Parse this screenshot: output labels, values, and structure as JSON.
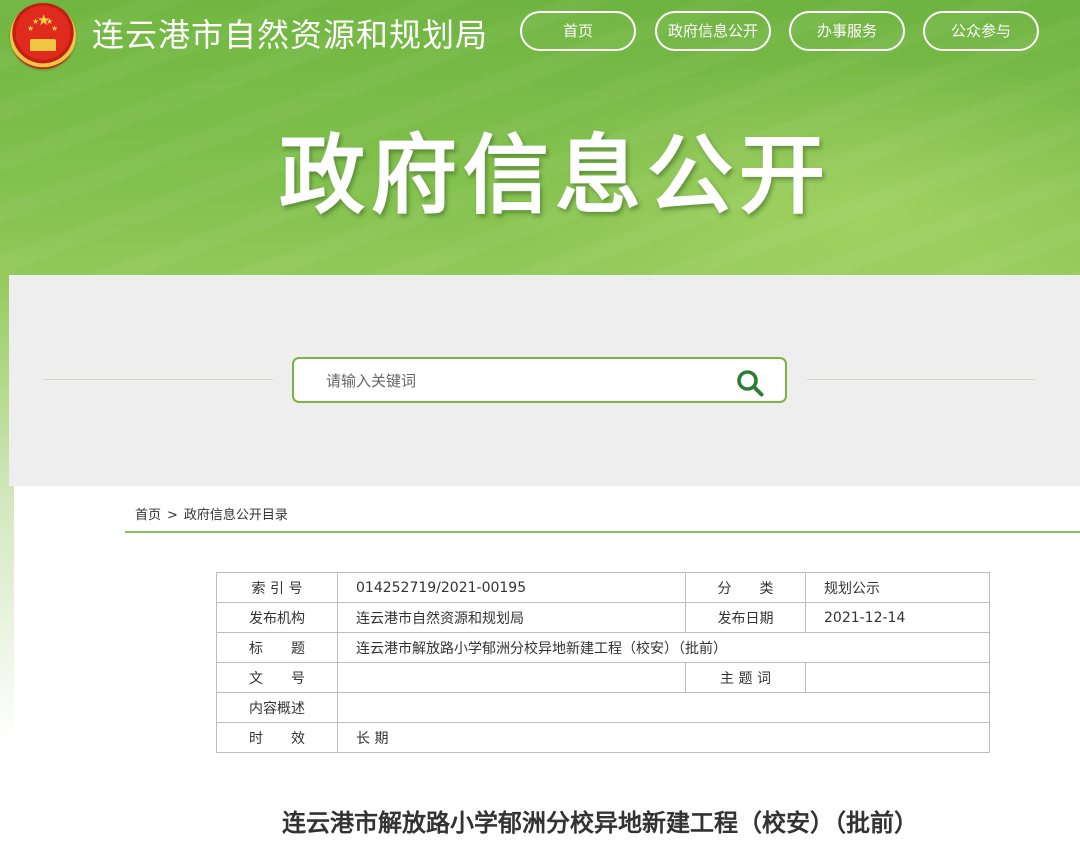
{
  "header": {
    "site_title": "连云港市自然资源和规划局",
    "nav": [
      {
        "label": "首页"
      },
      {
        "label": "政府信息公开"
      },
      {
        "label": "办事服务"
      },
      {
        "label": "公众参与"
      }
    ],
    "banner_title": "政府信息公开"
  },
  "search": {
    "placeholder": "请输入关键词",
    "accent_color": "#7cb342"
  },
  "breadcrumb": {
    "home": "首页",
    "separator": ">",
    "current": "政府信息公开目录"
  },
  "meta_table": {
    "index_label": "索 引 号",
    "index_value": "014252719/2021-00195",
    "category_label": "分　　类",
    "category_value": "规划公示",
    "publisher_label": "发布机构",
    "publisher_value": "连云港市自然资源和规划局",
    "date_label": "发布日期",
    "date_value": "2021-12-14",
    "title_label": "标　　题",
    "title_value": "连云港市解放路小学郁洲分校异地新建工程（校安）（批前）",
    "docno_label": "文　　号",
    "docno_value": "",
    "keywords_label": "主 题 词",
    "keywords_value": "",
    "summary_label": "内容概述",
    "summary_value": "",
    "validity_label": "时　　效",
    "validity_value": "长 期"
  },
  "document": {
    "title": "连云港市解放路小学郁洲分校异地新建工程（校安）（批前）"
  },
  "colors": {
    "header_green": "#7fbe4c",
    "divider_green": "#8dc15b"
  }
}
